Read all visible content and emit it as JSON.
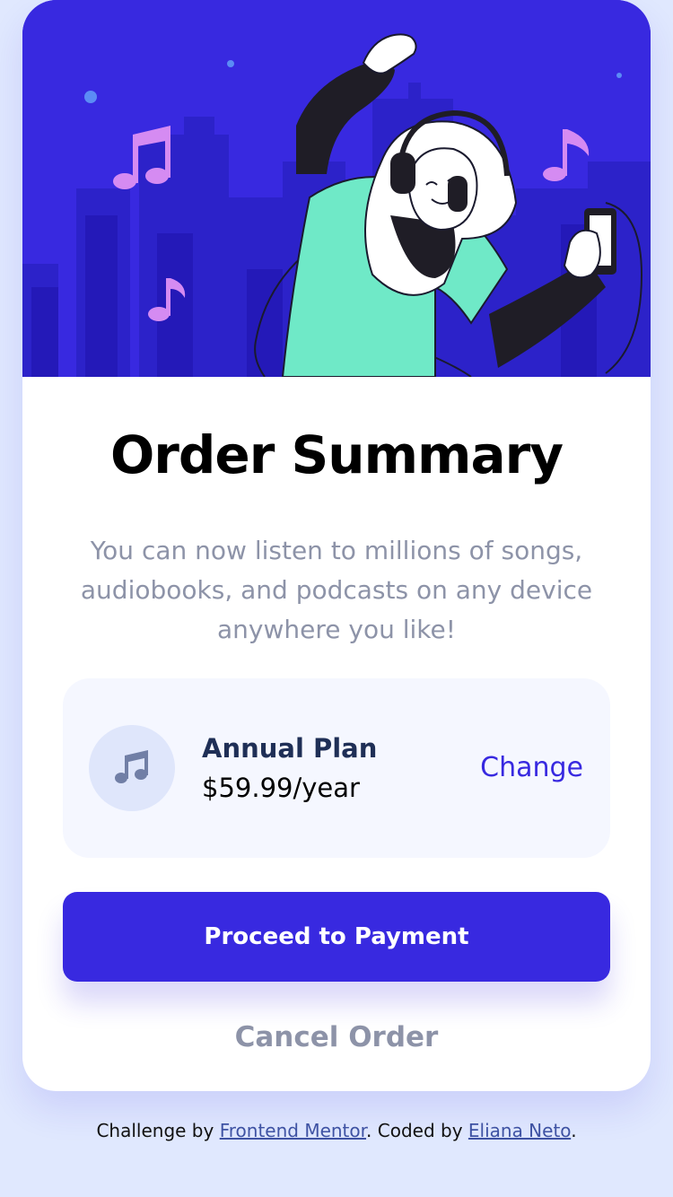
{
  "card": {
    "title": "Order Summary",
    "description": "You can now listen to millions of songs, audiobooks, and podcasts on any device anywhere you like!"
  },
  "hero": {
    "illustration": "woman-dancing-with-headphones-illustration",
    "icons": [
      "music-note-icon"
    ]
  },
  "plan": {
    "icon": "music-note-icon",
    "name": "Annual Plan",
    "price": "$59.99/year",
    "change_label": "Change"
  },
  "actions": {
    "proceed_label": "Proceed to Payment",
    "cancel_label": "Cancel Order"
  },
  "attribution": {
    "prefix": "Challenge by ",
    "link1": "Frontend Mentor",
    "middle": ". Coded by ",
    "link2": "Eliana Neto",
    "suffix": "."
  },
  "colors": {
    "background": "#e0e8fe",
    "accent": "#3829e0",
    "muted_text": "#8d93a8",
    "plan_bg": "#f5f7ff"
  }
}
